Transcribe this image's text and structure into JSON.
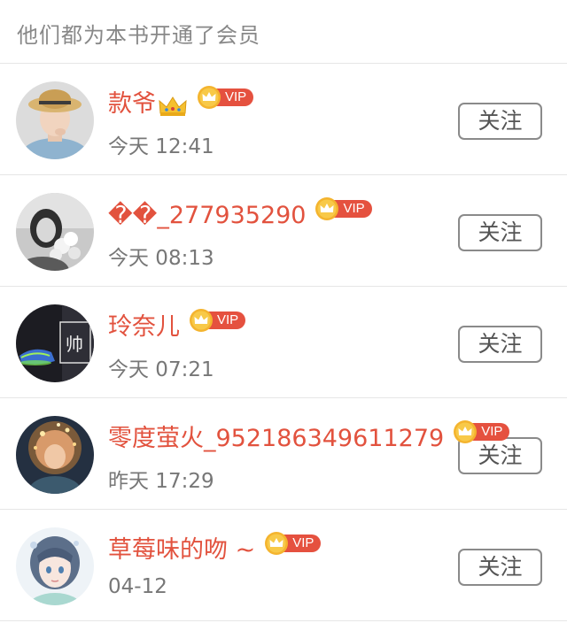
{
  "header": {
    "title": "他们都为本书开通了会员"
  },
  "vip_label": "VIP",
  "follow_label": "关注",
  "colors": {
    "username": "#e2523e",
    "vip_badge": "#e5513f",
    "crown_gold": "#f2b42c"
  },
  "members": [
    {
      "name": "款爷",
      "time": "今天 12:41",
      "avatar_icon": "boy-in-hat-avatar",
      "name_emoji": "crown-emoji"
    },
    {
      "name": "��_277935290",
      "time": "今天 08:13",
      "avatar_icon": "girl-with-flowers-avatar"
    },
    {
      "name": "玲奈儿",
      "time": "今天 07:21",
      "avatar_icon": "dark-neon-avatar"
    },
    {
      "name": "零度萤火_952186349611279",
      "time": "昨天 17:29",
      "avatar_icon": "sparkle-girl-avatar"
    },
    {
      "name": "草莓味的吻 ~",
      "time": "04-12",
      "avatar_icon": "anime-girl-avatar"
    }
  ]
}
